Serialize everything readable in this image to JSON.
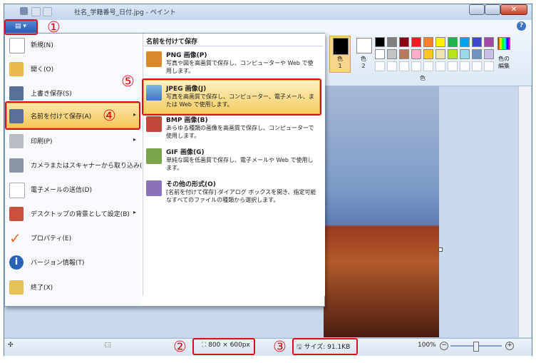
{
  "window": {
    "title": "社名_学籍番号_日付.jpg - ペイント"
  },
  "ribbon": {
    "app_button_label": "▤ ▾",
    "help": "?",
    "colors": {
      "color1_label": "色\n1",
      "color2_label": "色\n2",
      "group_label": "色",
      "edit_label": "色の\n編集",
      "palette": [
        "#000000",
        "#7f7f7f",
        "#880015",
        "#ed1c24",
        "#ff7f27",
        "#fff200",
        "#22b14c",
        "#00a2e8",
        "#3f48cc",
        "#a349a4",
        "#ffffff",
        "#c3c3c3",
        "#b97a57",
        "#ffaec9",
        "#ffc90e",
        "#efe4b0",
        "#b5e61d",
        "#99d9ea",
        "#7092be",
        "#c8bfe7"
      ]
    }
  },
  "annotations": {
    "n1": "①",
    "n2": "②",
    "n3": "③",
    "n4": "④",
    "n5": "⑤"
  },
  "app_menu": {
    "items": [
      {
        "label": "新規(N)"
      },
      {
        "label": "開く(O)"
      },
      {
        "label": "上書き保存(S)"
      },
      {
        "label": "名前を付けて保存(A)"
      },
      {
        "label": "印刷(P)"
      },
      {
        "label": "カメラまたはスキャナーから取り込み(M)"
      },
      {
        "label": "電子メールの送信(D)"
      },
      {
        "label": "デスクトップの背景として設定(B)"
      },
      {
        "label": "プロパティ(E)"
      },
      {
        "label": "バージョン情報(T)"
      },
      {
        "label": "終了(X)"
      }
    ],
    "submenu": {
      "title": "名前を付けて保存",
      "options": [
        {
          "title": "PNG 画像(P)",
          "desc": "写真や図を高画質で保存し、コンピューターや Web で使用します。"
        },
        {
          "title": "JPEG 画像(J)",
          "desc": "写真を高画質で保存し、コンピューター、電子メール、または Web で使用します。"
        },
        {
          "title": "BMP 画像(B)",
          "desc": "あらゆる種類の画像を高画質で保存し、コンピューターで使用します。"
        },
        {
          "title": "GIF 画像(G)",
          "desc": "単純な図を低画質で保存し、電子メールや Web で使用します。"
        },
        {
          "title": "その他の形式(O)",
          "desc": "[名前を付けて保存] ダイアログ ボックスを開き、指定可能なすべてのファイルの種類から選択します。"
        }
      ]
    }
  },
  "statusbar": {
    "move_icon": "✣",
    "select_icon": "⬚",
    "dimensions": "800 × 600px",
    "size": "サイズ: 91.1KB",
    "zoom": "100%",
    "zoom_out": "−",
    "zoom_in": "+"
  }
}
